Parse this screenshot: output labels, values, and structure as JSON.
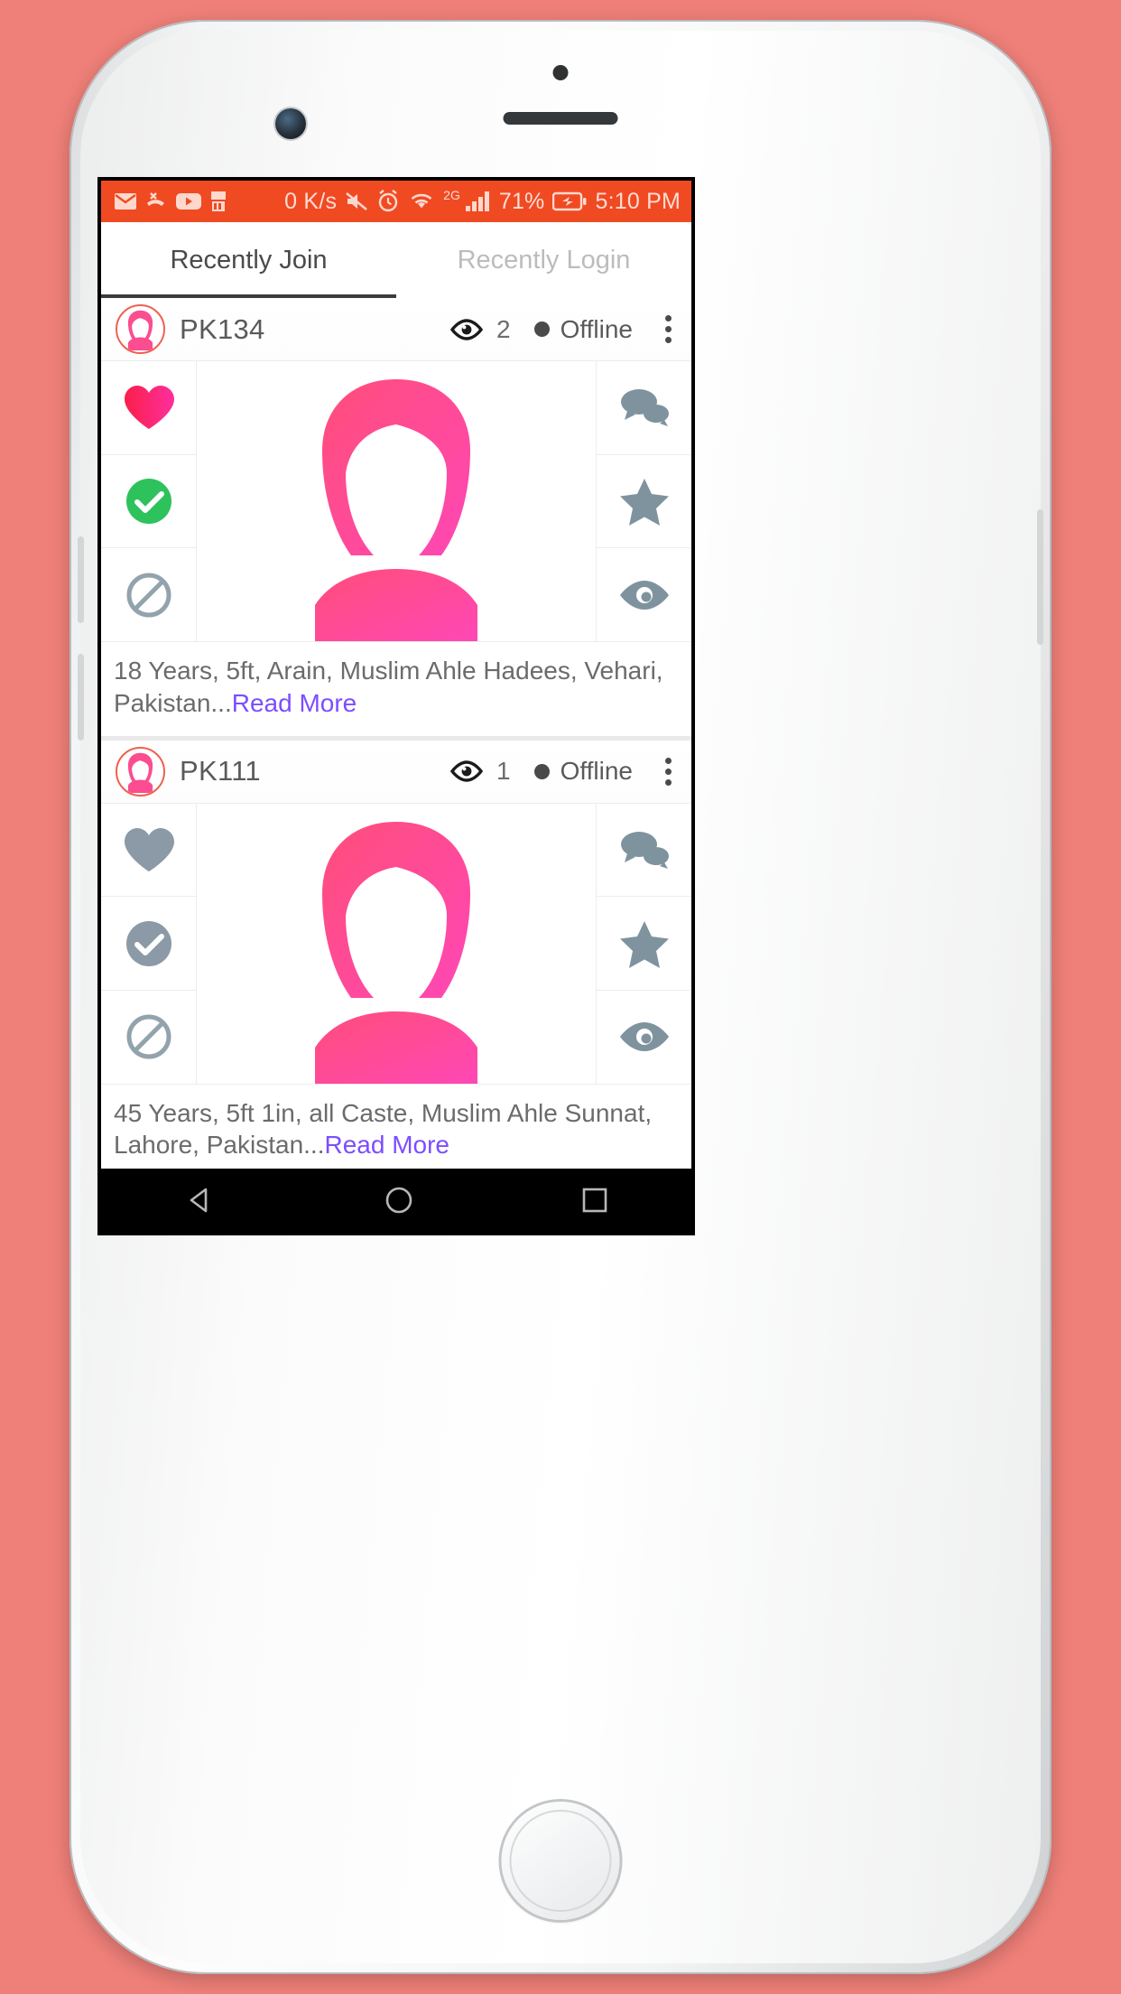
{
  "status_bar": {
    "left_icons": [
      "mail-icon",
      "missed-call-icon",
      "youtube-icon",
      "arabic-app-icon"
    ],
    "network_speed": "0 K/s",
    "mute_icon": "mute-icon",
    "alarm_icon": "alarm-icon",
    "wifi_icon": "wifi-icon",
    "network_type": "2G",
    "signal_icon": "signal-bars-icon",
    "battery_percent": "71%",
    "battery_icon": "battery-charging-icon",
    "time": "5:10 PM",
    "background_color": "#f04a23"
  },
  "tabs": [
    {
      "label": "Recently Join",
      "active": true
    },
    {
      "label": "Recently Login",
      "active": false
    }
  ],
  "cards": [
    {
      "username": "PK134",
      "view_count": "2",
      "status": "Offline",
      "description": "18 Years, 5ft, Arain, Muslim Ahle Hadees, Vehari, Pakistan...",
      "read_more": "Read More",
      "left_actions": [
        {
          "name": "like-heart-icon",
          "active": true,
          "color": "#fa2a5a"
        },
        {
          "name": "accept-check-icon",
          "active": true,
          "color": "#2ec25c"
        },
        {
          "name": "block-icon",
          "active": false,
          "color": "#93a3ad"
        }
      ],
      "right_actions": [
        {
          "name": "chat-icon",
          "active": false,
          "color": "#7f939f"
        },
        {
          "name": "favorite-star-icon",
          "active": false,
          "color": "#7f939f"
        },
        {
          "name": "view-profile-eye-icon",
          "active": false,
          "color": "#7f939f"
        }
      ]
    },
    {
      "username": "PK111",
      "view_count": "1",
      "status": "Offline",
      "description": "45 Years, 5ft 1in, all Caste, Muslim Ahle Sunnat, Lahore, Pakistan...",
      "read_more": "Read More",
      "left_actions": [
        {
          "name": "like-heart-icon",
          "active": false,
          "color": "#8b9aa6"
        },
        {
          "name": "accept-check-icon",
          "active": false,
          "color": "#8b9aa6"
        },
        {
          "name": "block-icon",
          "active": false,
          "color": "#93a3ad"
        }
      ],
      "right_actions": [
        {
          "name": "chat-icon",
          "active": false,
          "color": "#7f939f"
        },
        {
          "name": "favorite-star-icon",
          "active": false,
          "color": "#7f939f"
        },
        {
          "name": "view-profile-eye-icon",
          "active": false,
          "color": "#7f939f"
        }
      ]
    }
  ],
  "nav_bar": {
    "back": "back-triangle-icon",
    "home": "home-circle-icon",
    "recents": "recents-square-icon"
  },
  "theme": {
    "accent": "#f04a23",
    "link": "#7c4dff",
    "avatar_pink": "#fb4d8f",
    "page_background": "#ef8079"
  }
}
